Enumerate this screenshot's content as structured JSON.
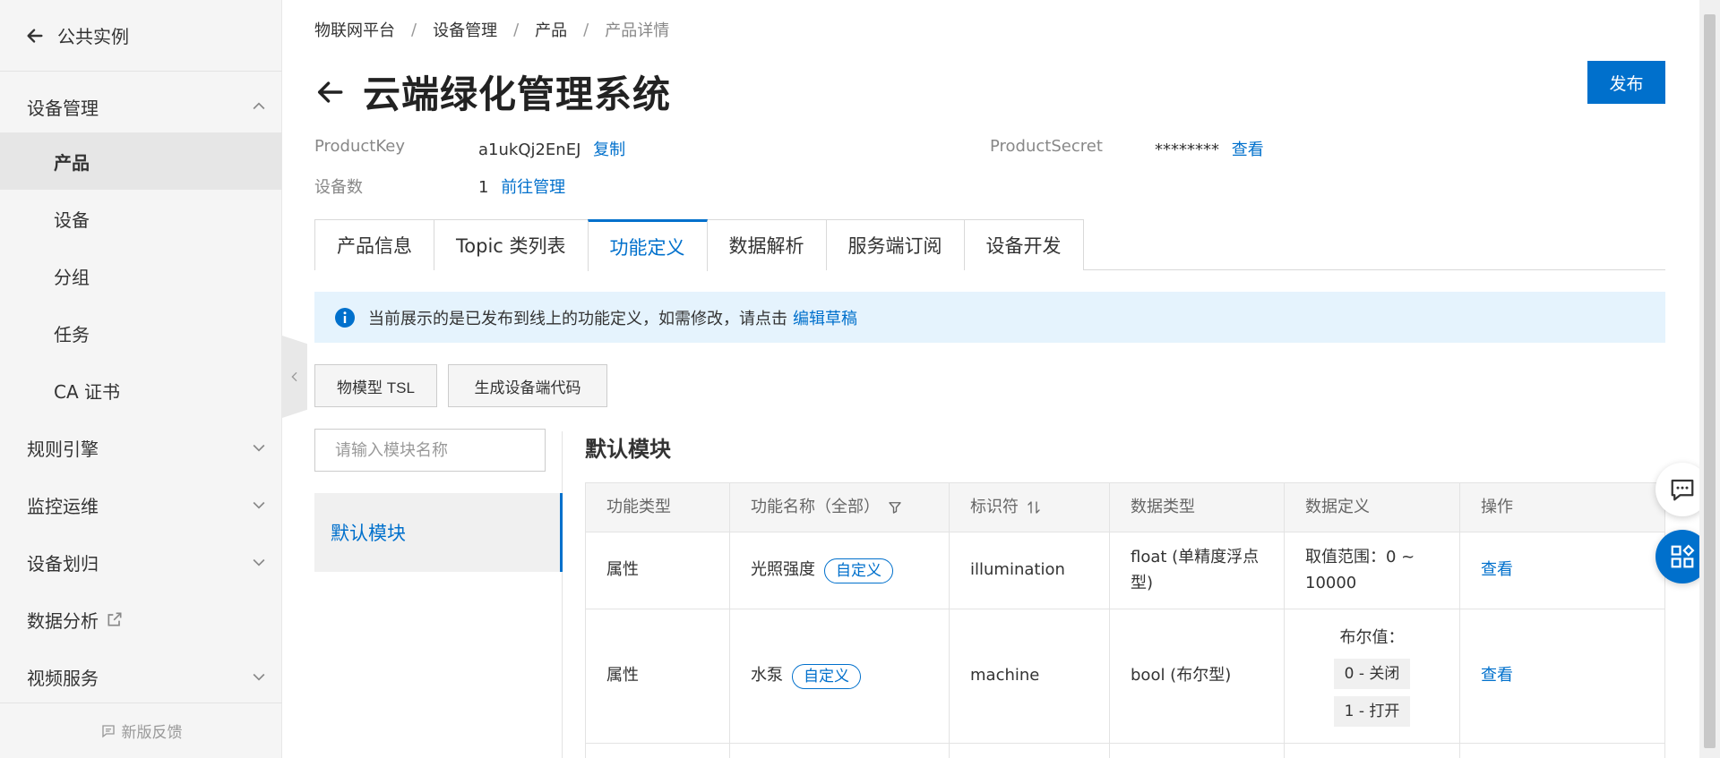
{
  "sidebar": {
    "back_label": "公共实例",
    "groups": [
      {
        "label": "设备管理",
        "expanded": true,
        "items": [
          {
            "label": "产品",
            "active": true
          },
          {
            "label": "设备"
          },
          {
            "label": "分组"
          },
          {
            "label": "任务"
          },
          {
            "label": "CA 证书"
          }
        ]
      },
      {
        "label": "规则引擎"
      },
      {
        "label": "监控运维"
      },
      {
        "label": "设备划归"
      },
      {
        "label": "数据分析",
        "icon": "external-link-icon"
      },
      {
        "label": "视频服务"
      }
    ],
    "feedback_label": "新版反馈"
  },
  "breadcrumb": [
    "物联网平台",
    "设备管理",
    "产品",
    "产品详情"
  ],
  "page_title": "云端绿化管理系统",
  "publish_label": "发布",
  "meta": {
    "product_key_label": "ProductKey",
    "product_key_value": "a1ukQj2EnEJ",
    "copy_label": "复制",
    "product_secret_label": "ProductSecret",
    "product_secret_value": "********",
    "view_label": "查看",
    "device_count_label": "设备数",
    "device_count_value": "1",
    "manage_label": "前往管理"
  },
  "tabs": [
    {
      "label": "产品信息"
    },
    {
      "label": "Topic 类列表"
    },
    {
      "label": "功能定义",
      "active": true
    },
    {
      "label": "数据解析"
    },
    {
      "label": "服务端订阅"
    },
    {
      "label": "设备开发"
    }
  ],
  "notice": {
    "text": "当前展示的是已发布到线上的功能定义，如需修改，请点击",
    "link": "编辑草稿"
  },
  "toolbar": {
    "tsl_label": "物模型 TSL",
    "codegen_label": "生成设备端代码"
  },
  "module_search": {
    "placeholder": "请输入模块名称"
  },
  "modules": [
    {
      "label": "默认模块",
      "active": true
    }
  ],
  "section_title": "默认模块",
  "table": {
    "headers": [
      "功能类型",
      "功能名称（全部）",
      "标识符",
      "数据类型",
      "数据定义",
      "操作"
    ],
    "rows": [
      {
        "type": "属性",
        "name": "光照强度",
        "tag": "自定义",
        "identifier": "illumination",
        "data_type": "float (单精度浮点型)",
        "definition": "取值范围：0 ~ 10000",
        "action": "查看"
      },
      {
        "type": "属性",
        "name": "水泵",
        "tag": "自定义",
        "identifier": "machine",
        "data_type": "bool (布尔型)",
        "definition_label": "布尔值：",
        "definition_values": [
          "0 - 关闭",
          "1 - 打开"
        ],
        "action": "查看"
      }
    ]
  },
  "colors": {
    "accent": "#0070cc",
    "notice_bg": "#e5f3fd",
    "sidebar_bg": "#f5f5f5"
  }
}
